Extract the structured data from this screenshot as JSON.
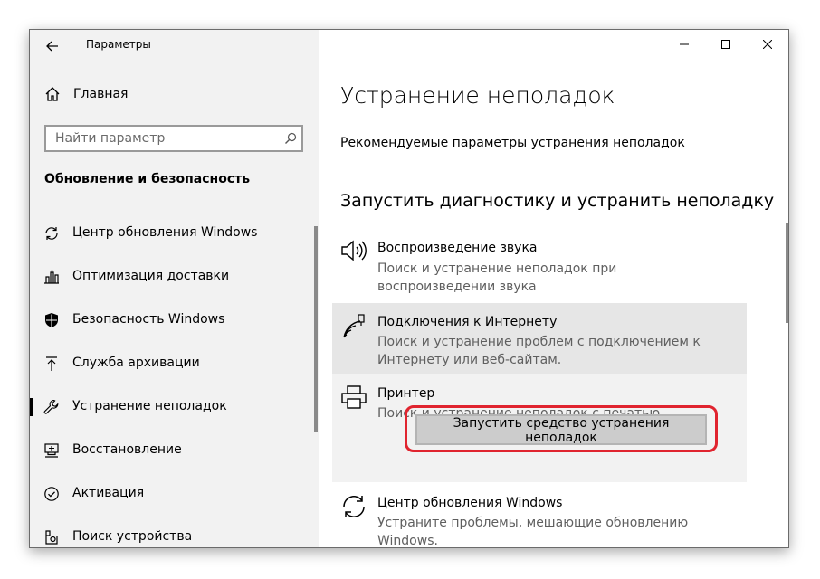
{
  "window": {
    "title": "Параметры"
  },
  "sidebar": {
    "home_label": "Главная",
    "search_placeholder": "Найти параметр",
    "section_title": "Обновление и безопасность",
    "items": [
      {
        "label": "Центр обновления Windows",
        "icon": "refresh-icon"
      },
      {
        "label": "Оптимизация доставки",
        "icon": "delivery-icon"
      },
      {
        "label": "Безопасность Windows",
        "icon": "shield-icon"
      },
      {
        "label": "Служба архивации",
        "icon": "backup-arrow-icon"
      },
      {
        "label": "Устранение неполадок",
        "icon": "wrench-icon",
        "selected": true
      },
      {
        "label": "Восстановление",
        "icon": "recovery-icon"
      },
      {
        "label": "Активация",
        "icon": "check-circle-icon"
      },
      {
        "label": "Поиск устройства",
        "icon": "find-device-icon"
      }
    ]
  },
  "main": {
    "title": "Устранение неполадок",
    "recommended_link": "Рекомендуемые параметры устранения неполадок",
    "subheading": "Запустить диагностику и устранить неполадку",
    "items": [
      {
        "title": "Воспроизведение звука",
        "desc": "Поиск и устранение неполадок при воспроизведении звука",
        "icon": "speaker-icon"
      },
      {
        "title": "Подключения к Интернету",
        "desc": "Поиск и устранение проблем с подключением к Интернету или веб-сайтам.",
        "icon": "wifi-icon"
      },
      {
        "title": "Принтер",
        "desc": "Поиск и устранение неполадок с печатью",
        "icon": "printer-icon"
      },
      {
        "title": "Центр обновления Windows",
        "desc": "Устраните проблемы, мешающие обновлению Windows.",
        "icon": "refresh-icon"
      }
    ],
    "run_button": "Запустить средство устранения неполадок"
  },
  "colors": {
    "sidebar_bg": "#f2f2f2",
    "hover_bg": "#e6e6e6",
    "selected_bg": "#f2f2f2",
    "highlight": "#e0242f",
    "button_bg": "#cccccc"
  }
}
